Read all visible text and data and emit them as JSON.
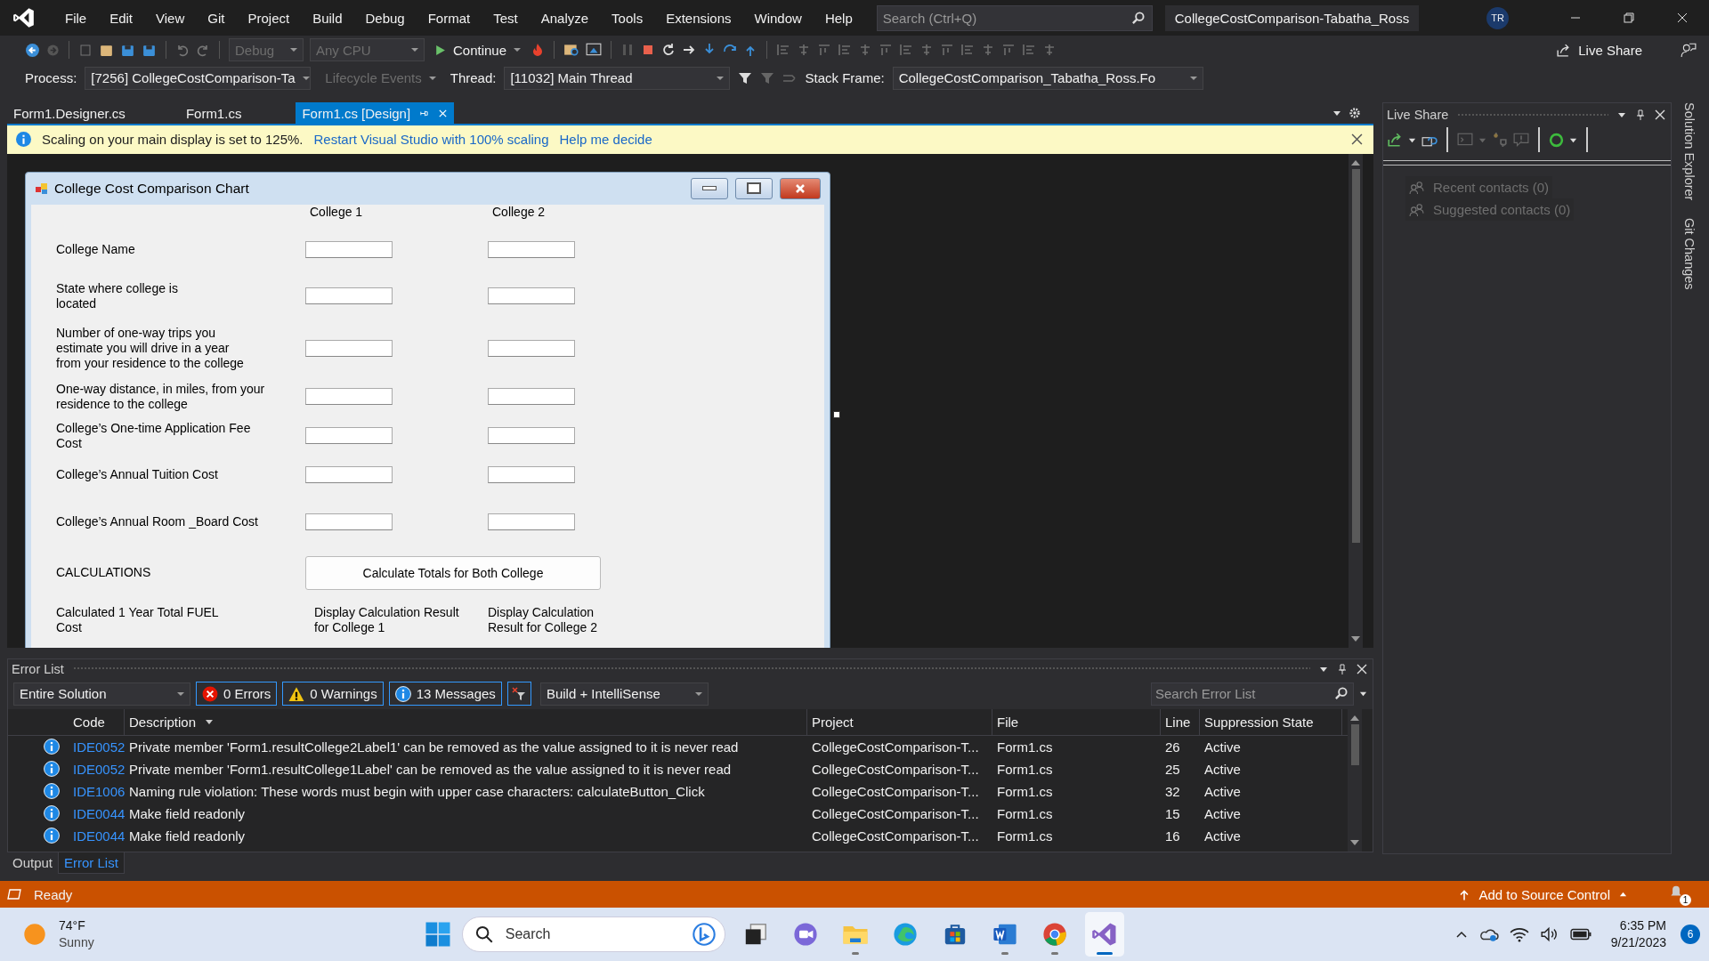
{
  "menu": [
    "File",
    "Edit",
    "View",
    "Git",
    "Project",
    "Build",
    "Debug",
    "Format",
    "Test",
    "Analyze",
    "Tools",
    "Extensions",
    "Window",
    "Help"
  ],
  "search": {
    "placeholder": "Search (Ctrl+Q)"
  },
  "window": {
    "title": "CollegeCostComparison-Tabatha_Ross",
    "avatar": "TR"
  },
  "toolbar": {
    "configuration": "Debug",
    "platform": "Any CPU",
    "continue": "Continue",
    "live_share": "Live Share"
  },
  "debug_bar": {
    "process_label": "Process:",
    "process": "[7256] CollegeCostComparison-Ta",
    "lifecycle": "Lifecycle Events",
    "thread_label": "Thread:",
    "thread": "[11032] Main Thread",
    "stack_label": "Stack Frame:",
    "stack": "CollegeCostComparison_Tabatha_Ross.Fo"
  },
  "tabs": [
    {
      "label": "Form1.Designer.cs",
      "selected": false
    },
    {
      "label": "Form1.cs",
      "selected": false
    },
    {
      "label": "Form1.cs [Design]",
      "selected": true
    }
  ],
  "infobar": {
    "message": "Scaling on your main display is set to 125%.",
    "links": [
      "Restart Visual Studio with 100% scaling",
      "Help me decide"
    ]
  },
  "form": {
    "title": "College Cost Comparison Chart",
    "columns": [
      "College 1",
      "College 2"
    ],
    "rows": [
      {
        "label": "College Name"
      },
      {
        "label": "State where college is located"
      },
      {
        "label": "Number of one-way trips you estimate you will drive in a year from your residence to the college"
      },
      {
        "label": "One-way distance, in miles, from your residence to the college"
      },
      {
        "label": "College’s One-time Application Fee Cost"
      },
      {
        "label": "College’s Annual Tuition Cost"
      },
      {
        "label": "College’s Annual Room _Board Cost"
      }
    ],
    "section": "CALCULATIONS",
    "button": "Calculate Totals for Both College",
    "result_label": "Calculated 1 Year Total FUEL Cost",
    "results": [
      "Display Calculation Result for College 1",
      "Display Calculation Result for College 2"
    ]
  },
  "live_share": {
    "title": "Live Share",
    "contacts": [
      "Recent contacts (0)",
      "Suggested contacts (0)"
    ]
  },
  "side_tabs": [
    "Solution Explorer",
    "Git Changes"
  ],
  "error_list": {
    "title": "Error List",
    "scope": "Entire Solution",
    "filters": [
      {
        "kind": "error",
        "label": "0 Errors",
        "selected": true
      },
      {
        "kind": "warning",
        "label": "0 Warnings",
        "selected": true
      },
      {
        "kind": "message",
        "label": "13 Messages",
        "selected": true
      }
    ],
    "source": "Build + IntelliSense",
    "search_placeholder": "Search Error List",
    "columns": [
      "Code",
      "Description",
      "Project",
      "File",
      "Line",
      "Suppression State"
    ],
    "rows": [
      {
        "code": "IDE0052",
        "description": "Private member 'Form1.resultCollege2Label1' can be removed as the value assigned to it is never read",
        "project": "CollegeCostComparison-T...",
        "file": "Form1.cs",
        "line": "26",
        "state": "Active"
      },
      {
        "code": "IDE0052",
        "description": "Private member 'Form1.resultCollege1Label' can be removed as the value assigned to it is never read",
        "project": "CollegeCostComparison-T...",
        "file": "Form1.cs",
        "line": "25",
        "state": "Active"
      },
      {
        "code": "IDE1006",
        "description": "Naming rule violation: These words must begin with upper case characters: calculateButton_Click",
        "project": "CollegeCostComparison-T...",
        "file": "Form1.cs",
        "line": "32",
        "state": "Active"
      },
      {
        "code": "IDE0044",
        "description": "Make field readonly",
        "project": "CollegeCostComparison-T...",
        "file": "Form1.cs",
        "line": "15",
        "state": "Active"
      },
      {
        "code": "IDE0044",
        "description": "Make field readonly",
        "project": "CollegeCostComparison-T...",
        "file": "Form1.cs",
        "line": "16",
        "state": "Active"
      }
    ]
  },
  "bottom_tabs": [
    {
      "label": "Output",
      "selected": false
    },
    {
      "label": "Error List",
      "selected": true
    }
  ],
  "status_bar": {
    "text": "Ready",
    "source_control": "Add to Source Control",
    "notifications": "1"
  },
  "taskbar": {
    "temperature": "74°F",
    "weather": "Sunny",
    "search": "Search",
    "apps": [
      {
        "kind": "taskview",
        "running": false,
        "selected": false
      },
      {
        "kind": "teams",
        "running": false,
        "selected": false
      },
      {
        "kind": "files",
        "running": true,
        "selected": false
      },
      {
        "kind": "edge",
        "running": false,
        "selected": false
      },
      {
        "kind": "store",
        "running": false,
        "selected": false
      },
      {
        "kind": "word",
        "running": true,
        "selected": false
      },
      {
        "kind": "chrome",
        "running": true,
        "selected": false
      },
      {
        "kind": "vs",
        "running": true,
        "selected": true
      }
    ],
    "time": "6:35 PM",
    "date": "9/21/2023",
    "badge": "6"
  }
}
